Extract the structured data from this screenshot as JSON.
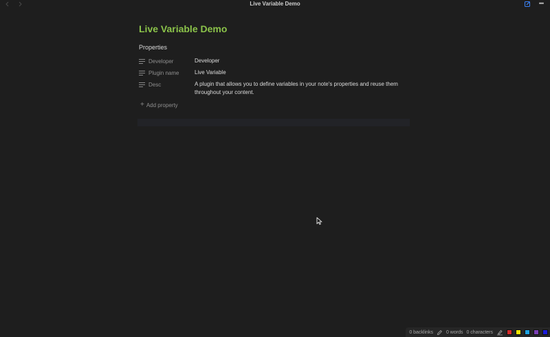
{
  "window": {
    "title": "Live Variable Demo",
    "back_icon": "arrow-left-icon",
    "forward_icon": "arrow-right-icon",
    "edit_icon": "edit-icon",
    "more_icon": "more-options-icon"
  },
  "note": {
    "title": "Live Variable Demo",
    "title_color": "#8bc34a",
    "properties_heading": "Properties",
    "properties": [
      {
        "key": "Developer",
        "value": "Developer",
        "icon": "text-lines-icon"
      },
      {
        "key": "Plugin name",
        "value": "Live Variable",
        "icon": "text-lines-icon"
      },
      {
        "key": "Desc",
        "value": "A plugin that allows you to define variables in your note's properties and reuse them throughout your content.",
        "icon": "text-lines-icon"
      }
    ],
    "add_property_label": "Add property"
  },
  "statusbar": {
    "backlinks": "0 backlinks",
    "words": "0 words",
    "characters": "0 characters",
    "swatches": [
      "#d42a2a",
      "#f5e600",
      "#1da1e0",
      "#7b3fb5",
      "#1a1adb"
    ]
  }
}
